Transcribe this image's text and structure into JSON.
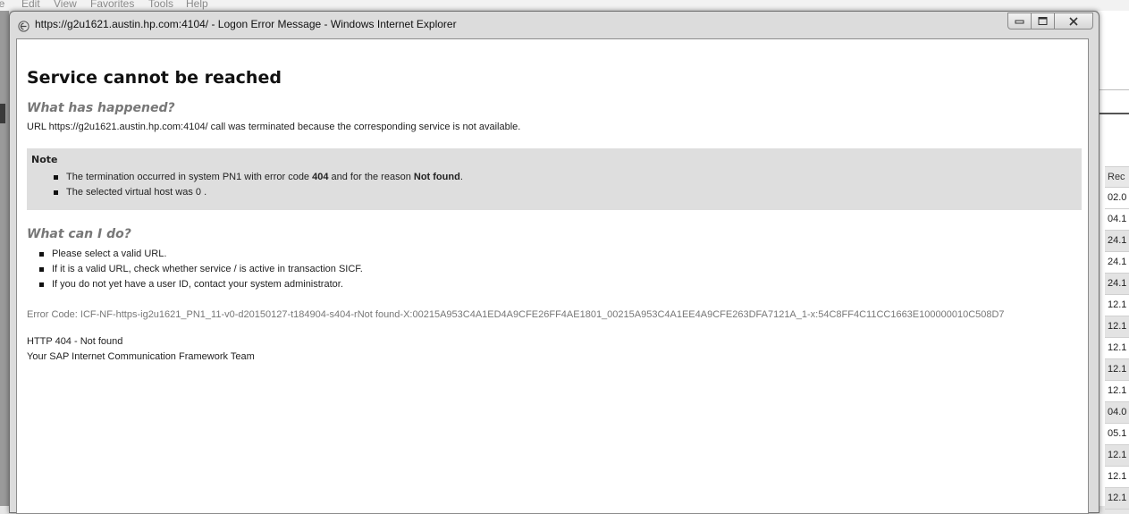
{
  "background_app": {
    "menu": [
      "le",
      "Edit",
      "View",
      "Favorites",
      "Tools",
      "Help"
    ],
    "table": {
      "column_header": "Rec",
      "rows": [
        "02.0",
        "04.1",
        "24.1",
        "24.1",
        "24.1",
        "12.1",
        "12.1",
        "12.1",
        "12.1",
        "12.1",
        "04.0",
        "05.1",
        "12.1",
        "12.1",
        "12.1"
      ]
    }
  },
  "window": {
    "title": "https://g2u1621.austin.hp.com:4104/ - Logon Error Message - Windows Internet Explorer",
    "icon": "ie-page-icon",
    "controls": [
      "minimize-icon",
      "maximize-icon",
      "close-icon"
    ]
  },
  "page": {
    "title": "Service cannot be reached",
    "what_happened": {
      "heading": "What has happened?",
      "message": "URL https://g2u1621.austin.hp.com:4104/ call was terminated because the corresponding service is not available."
    },
    "note": {
      "title": "Note",
      "item1": {
        "prefix": "The termination occurred in system PN1 with error code ",
        "code": "404",
        "middle": " and for the reason ",
        "reason": "Not found",
        "suffix": "."
      },
      "item2": "The selected virtual host was 0 ."
    },
    "what_can_i_do": {
      "heading": "What can I do?",
      "items": [
        "Please select a valid URL.",
        "If it is a valid URL, check whether service / is active in transaction SICF.",
        "If you do not yet have a user ID, contact your system administrator."
      ]
    },
    "error_code": "Error Code: ICF-NF-https-ig2u1621_PN1_11-v0-d20150127-t184904-s404-rNot found-X:00215A953C4A1ED4A9CFE26FF4AE1801_00215A953C4A1EE4A9CFE263DFA7121A_1-x:54C8FF4C11CC1663E100000010C508D7",
    "http_status": "HTTP 404 - Not found",
    "team": "Your SAP Internet Communication Framework Team"
  }
}
